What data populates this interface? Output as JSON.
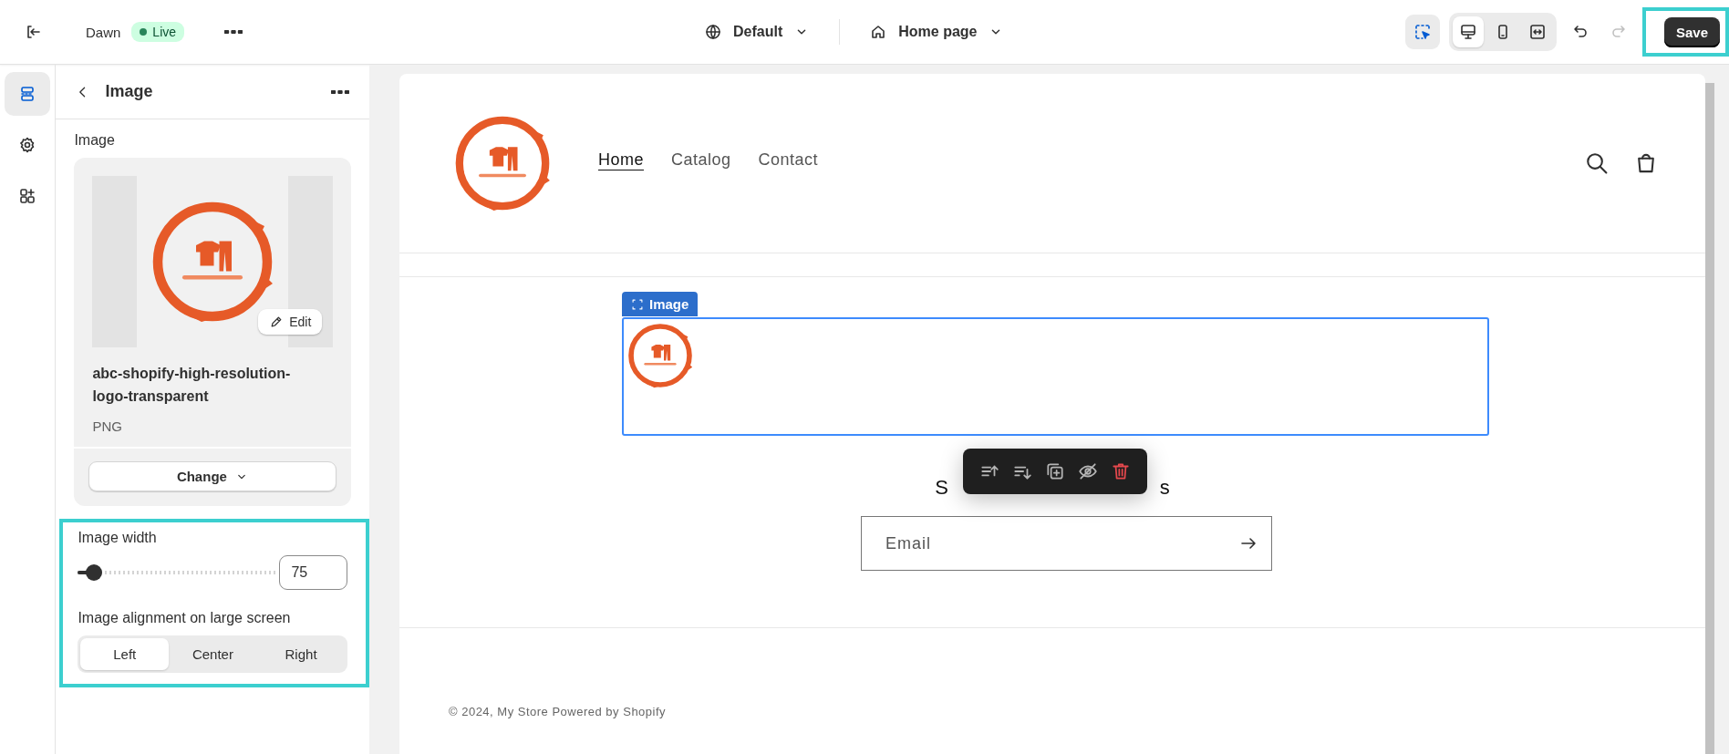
{
  "top_bar": {
    "theme_name": "Dawn",
    "status_badge": "Live",
    "language": "Default",
    "page": "Home page",
    "inspector": {
      "selected": true
    },
    "devices": [
      {
        "kind": "desktop",
        "selected": true
      },
      {
        "kind": "mobile",
        "selected": false
      },
      {
        "kind": "fullwidth",
        "selected": false
      }
    ],
    "redo_disabled": true,
    "save": {
      "label": "Save",
      "highlighted": true
    }
  },
  "rail": [
    {
      "kind": "sections",
      "selected": true
    },
    {
      "kind": "settings",
      "selected": false
    },
    {
      "kind": "apps",
      "selected": false
    }
  ],
  "panel": {
    "title": "Image",
    "field_label": "Image",
    "image": {
      "kind": "picture",
      "edit": "Edit",
      "filename": "abc-shopify-high-resolution-logo-transparent",
      "format": "PNG",
      "change": "Change"
    },
    "settings_highlighted": true,
    "width": {
      "label": "Image width",
      "level": 0.08,
      "value": "75"
    },
    "alignment": {
      "label": "Image alignment on large screen",
      "options": [
        {
          "label": "Left",
          "selected": true
        },
        {
          "label": "Center",
          "selected": false
        },
        {
          "label": "Right",
          "selected": false
        }
      ]
    }
  },
  "preview": {
    "nav": [
      {
        "label": "Home",
        "selected": true
      },
      {
        "label": "Catalog",
        "selected": false
      },
      {
        "label": "Contact",
        "selected": false
      }
    ],
    "block_tag": "Image",
    "heading_start": "S",
    "heading_end": "s",
    "toolbar": [
      {
        "kind": "move-up"
      },
      {
        "kind": "move-down"
      },
      {
        "kind": "duplicate"
      },
      {
        "kind": "hide"
      },
      {
        "kind": "delete"
      }
    ],
    "email_placeholder": "Email",
    "footer": "© 2024, My Store Powered by Shopify"
  }
}
